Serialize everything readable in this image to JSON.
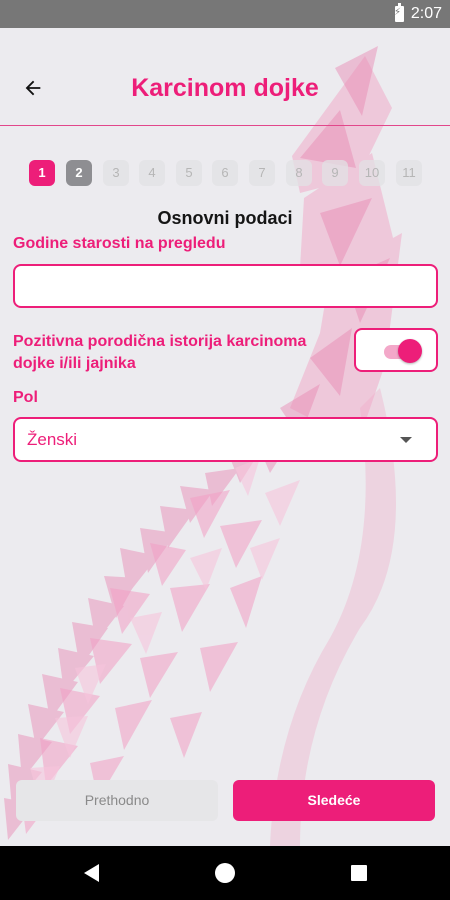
{
  "status_bar": {
    "time": "2:07"
  },
  "app_bar": {
    "title": "Karcinom dojke",
    "back_icon": "arrow-left-icon"
  },
  "steps": {
    "items": [
      "1",
      "2",
      "3",
      "4",
      "5",
      "6",
      "7",
      "8",
      "9",
      "10",
      "11"
    ],
    "active": "1",
    "completed": [
      "2",
      "9",
      "10"
    ]
  },
  "form": {
    "section_title": "Osnovni podaci",
    "age_label": "Godine starosti na pregledu",
    "age_value": "",
    "family_history_label": "Pozitivna porodična istorija karcinoma dojke i/ili jajnika",
    "family_history_enabled": true,
    "sex_label": "Pol",
    "sex_value": "Ženski"
  },
  "buttons": {
    "previous": "Prethodno",
    "next": "Sledeće"
  },
  "colors": {
    "accent": "#ed1e79",
    "background": "#ecebef"
  }
}
